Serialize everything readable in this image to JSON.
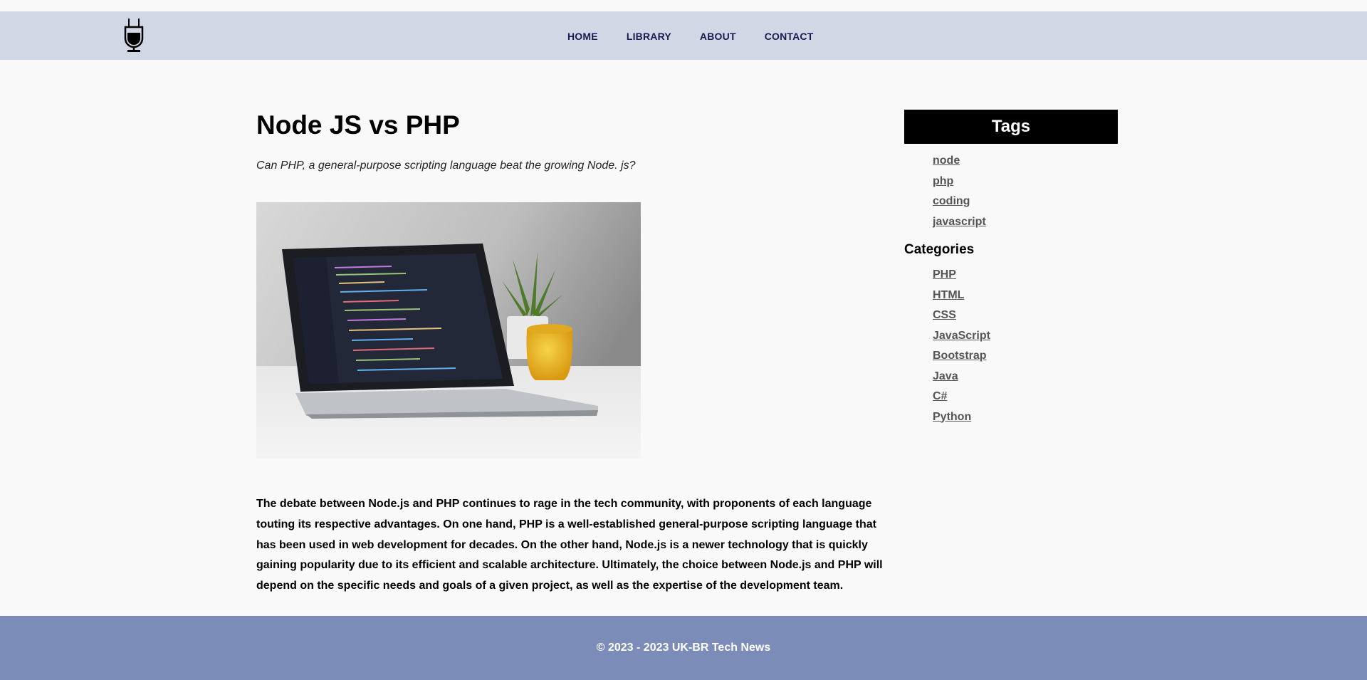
{
  "nav": {
    "links": [
      "HOME",
      "LIBRARY",
      "ABOUT",
      "CONTACT"
    ]
  },
  "article": {
    "title": "Node JS vs PHP",
    "subtitle": "Can PHP, a general-purpose scripting language beat the growing Node. js?",
    "body": "The debate between Node.js and PHP continues to rage in the tech community, with proponents of each language touting its respective advantages. On one hand, PHP is a well-established general-purpose scripting language that has been used in web development for decades. On the other hand, Node.js is a newer technology that is quickly gaining popularity due to its efficient and scalable architecture. Ultimately, the choice between Node.js and PHP will depend on the specific needs and goals of a given project, as well as the expertise of the development team."
  },
  "sidebar": {
    "tags_title": "Tags",
    "tags": [
      "node",
      "php",
      "coding",
      "javascript"
    ],
    "categories_title": "Categories",
    "categories": [
      "PHP",
      "HTML",
      "CSS",
      "JavaScript",
      "Bootstrap",
      "Java",
      "C#",
      "Python"
    ]
  },
  "footer": {
    "text": "© 2023 - 2023 UK-BR Tech News"
  },
  "colors": {
    "navbar": "#d2d7e5",
    "nav_text": "#1e1a52",
    "footer": "#7b8cb8",
    "tags_header": "#000000"
  },
  "icons": {
    "logo": "microphone-icon"
  }
}
